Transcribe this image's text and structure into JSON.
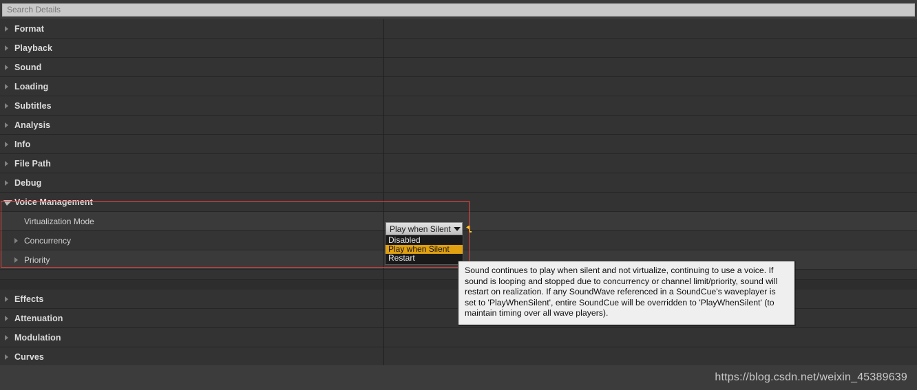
{
  "search": {
    "placeholder": "Search Details",
    "value": ""
  },
  "details_panel": {
    "rows": [
      {
        "label": "Format",
        "type": "category",
        "expanded": false
      },
      {
        "label": "Playback",
        "type": "category",
        "expanded": false
      },
      {
        "label": "Sound",
        "type": "category",
        "expanded": false
      },
      {
        "label": "Loading",
        "type": "category",
        "expanded": false
      },
      {
        "label": "Subtitles",
        "type": "category",
        "expanded": false
      },
      {
        "label": "Analysis",
        "type": "category",
        "expanded": false
      },
      {
        "label": "Info",
        "type": "category",
        "expanded": false
      },
      {
        "label": "File Path",
        "type": "category",
        "expanded": false
      },
      {
        "label": "Debug",
        "type": "category",
        "expanded": false
      },
      {
        "label": "Voice Management",
        "type": "category",
        "expanded": true
      },
      {
        "label": "Virtualization Mode",
        "type": "property",
        "expandable": false
      },
      {
        "label": "Concurrency",
        "type": "property",
        "expandable": true
      },
      {
        "label": "Priority",
        "type": "property",
        "expandable": true
      },
      {
        "label": "Effects",
        "type": "category",
        "expanded": false
      },
      {
        "label": "Attenuation",
        "type": "category",
        "expanded": false
      },
      {
        "label": "Modulation",
        "type": "category",
        "expanded": false
      },
      {
        "label": "Curves",
        "type": "category",
        "expanded": false
      }
    ]
  },
  "virtualization_mode": {
    "selected": "Play when Silent",
    "options": [
      "Disabled",
      "Play when Silent",
      "Restart"
    ],
    "reset_icon": "reset-to-default-icon",
    "highlight_color": "#e0a010"
  },
  "tooltip": {
    "text": "Sound continues to play when silent and not virtualize, continuing to use a voice. If sound is looping and stopped due to concurrency or channel limit/priority, sound will restart on realization. If any SoundWave referenced in a SoundCue's waveplayer is set to 'PlayWhenSilent', entire SoundCue will be overridden to 'PlayWhenSilent' (to maintain timing over all wave players)."
  },
  "annotation": {
    "color": "#f1463f"
  },
  "footer": {
    "watermark": "https://blog.csdn.net/weixin_45389639"
  }
}
